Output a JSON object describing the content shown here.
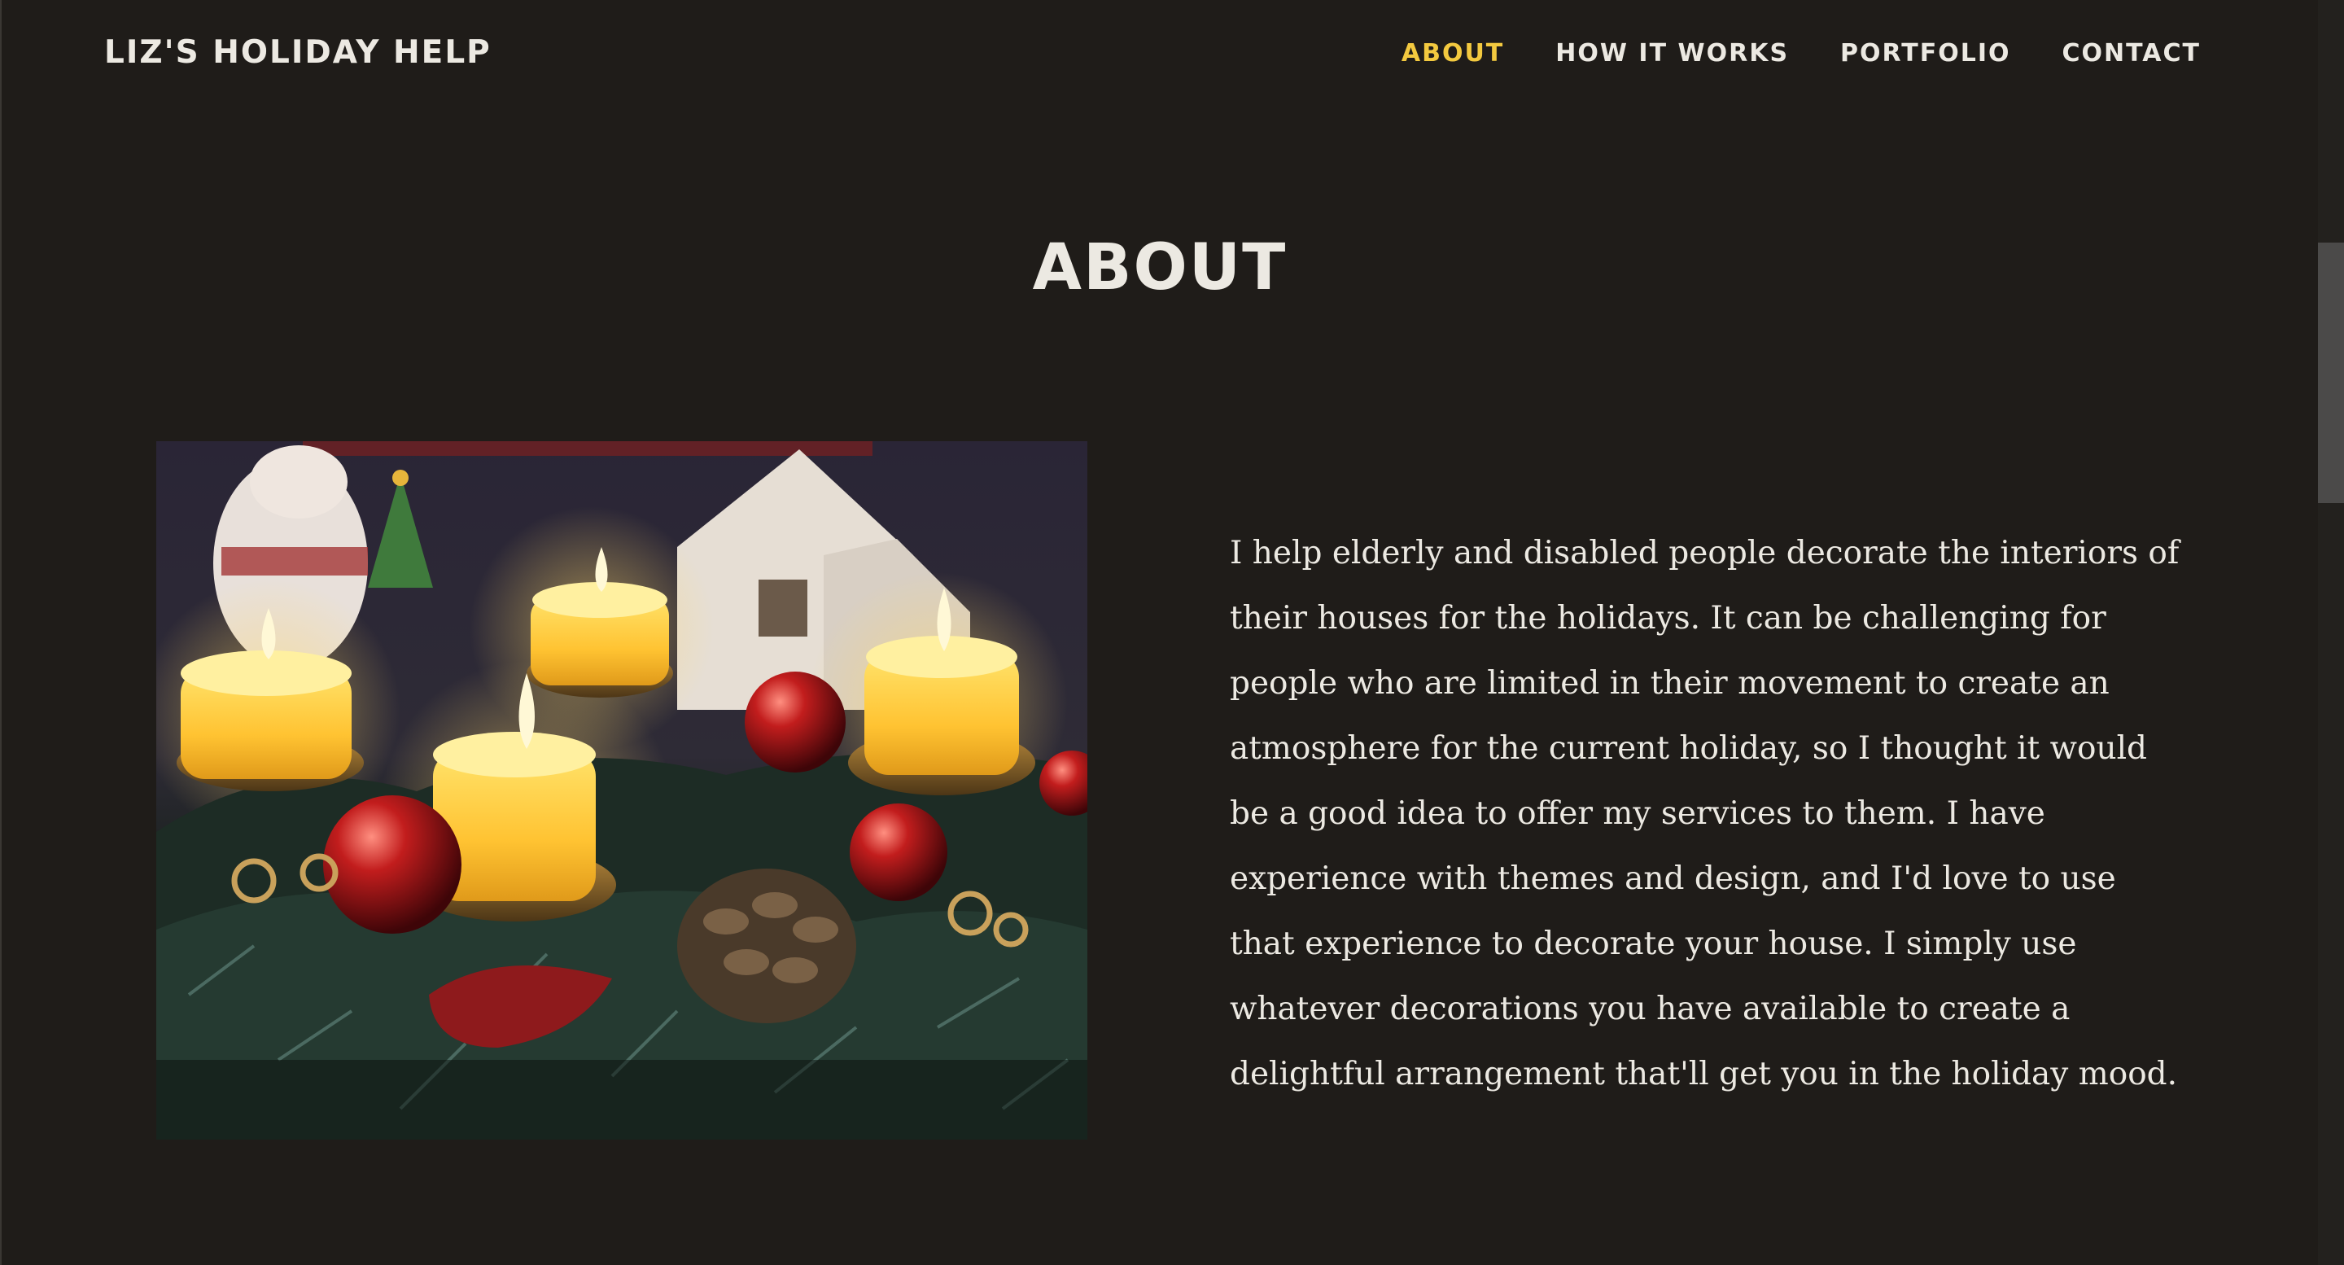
{
  "header": {
    "brand": "LIZ'S HOLIDAY HELP",
    "nav": [
      {
        "label": "ABOUT",
        "active": true
      },
      {
        "label": "HOW IT WORKS",
        "active": false
      },
      {
        "label": "PORTFOLIO",
        "active": false
      },
      {
        "label": "CONTACT",
        "active": false
      }
    ]
  },
  "about": {
    "title": "ABOUT",
    "body": "I help elderly and disabled people decorate the interiors of their houses for the holidays. It can be challenging for people who are limited in their movement to create an atmosphere for the current holiday, so I thought it would be a good idea to offer my services to them. I have experience with themes and design, and I'd love to use that experience to decorate your house. I simply use whatever decorations you have available to create a delightful arrangement that'll get you in the holiday mood."
  },
  "colors": {
    "background": "#1f1c19",
    "text": "#ece9e2",
    "accent": "#f3c93f"
  }
}
